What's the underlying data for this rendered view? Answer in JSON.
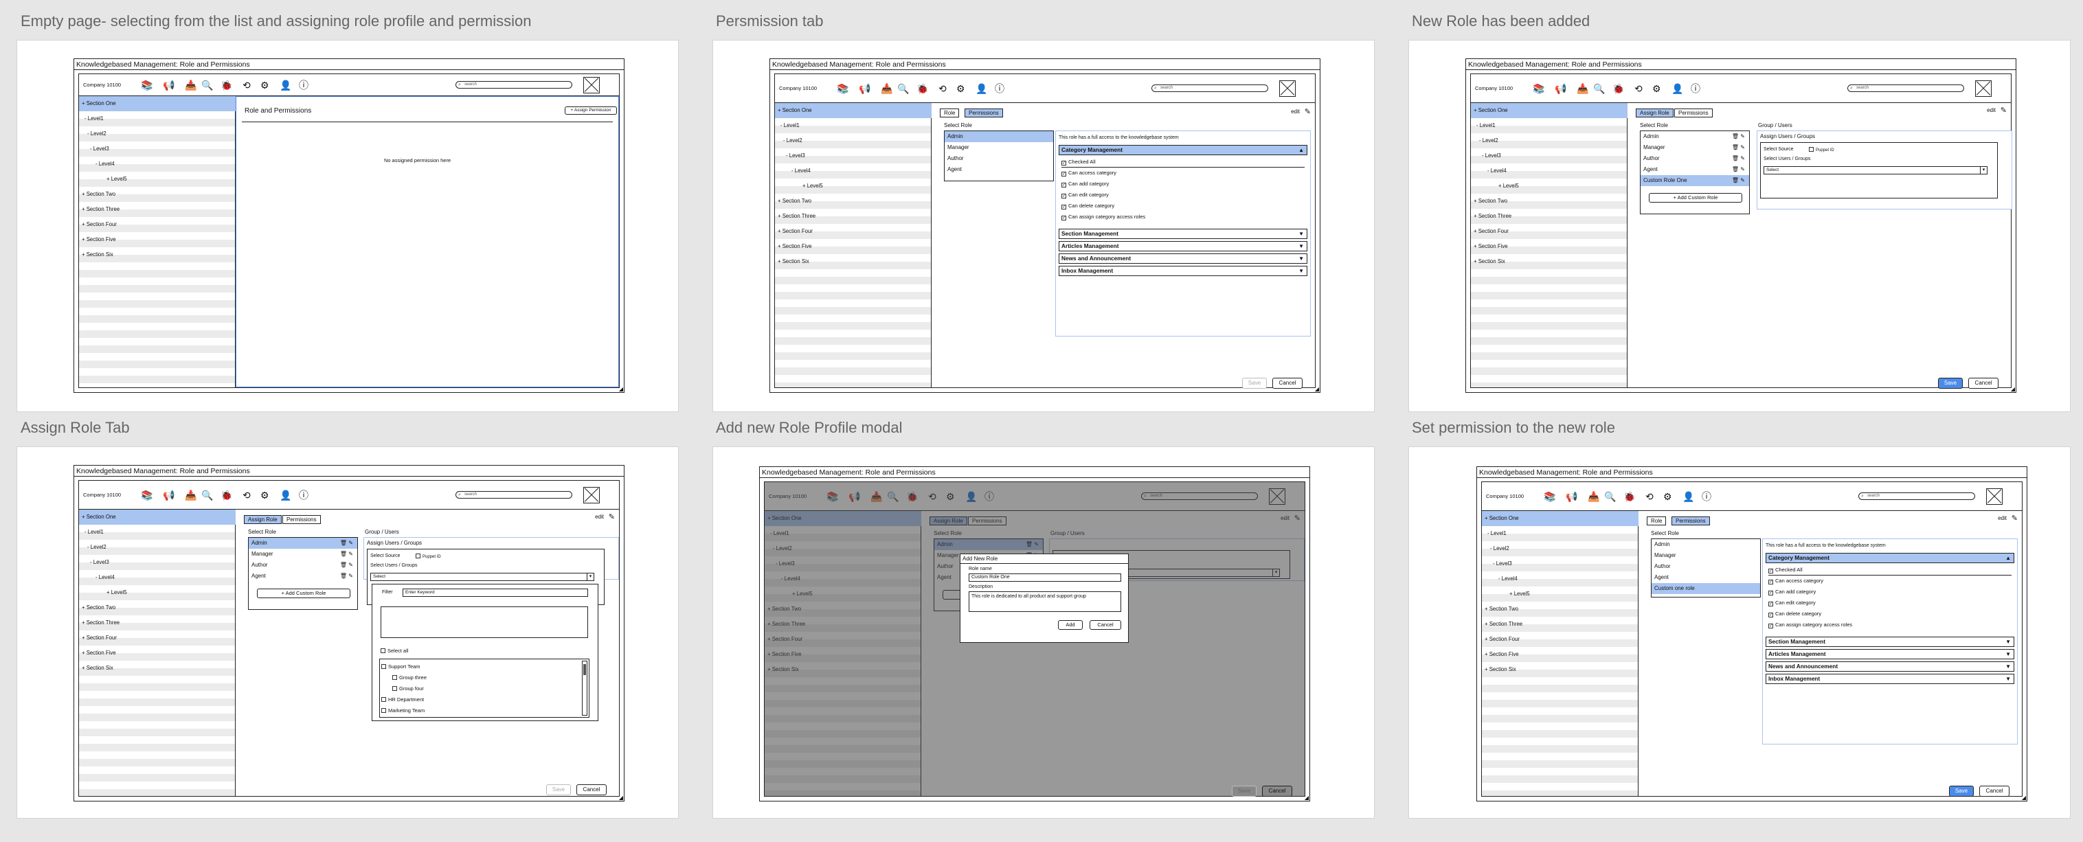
{
  "panels": [
    {
      "title": "Empty page- selecting from the list and assigning role profile and permission"
    },
    {
      "title": "Persmission tab"
    },
    {
      "title": "New Role has been added"
    },
    {
      "title": "Assign Role Tab"
    },
    {
      "title": "Add new Role Profile modal"
    },
    {
      "title": "Set permission to the new role"
    }
  ],
  "app": {
    "window_title": "Knowledgebased Management: Role and Permissions",
    "company": "Company 10100",
    "search_placeholder": "search",
    "toolbar_icons": [
      "library-icon",
      "megaphone-icon",
      "inbox-icon",
      "search-icon",
      "bug-icon",
      "history-icon",
      "gear-icon",
      "user-check-icon",
      "help-icon"
    ]
  },
  "sidebar": {
    "items": [
      "+ Section One",
      "- Level1",
      "- Level2",
      "- Level3",
      "- Level4",
      "+ Level5",
      "+ Section Two",
      "+ Section Three",
      "+ Section Four",
      "+ Section Five",
      "+ Section Six"
    ]
  },
  "empty": {
    "heading": "Role and Permissions",
    "assign_button": "+ Assign Permission",
    "empty_text": "No assigned permission here"
  },
  "tabs": {
    "role": "Role",
    "assign_role": "Assign Role",
    "permissions": "Permissions"
  },
  "edit_label": "edit",
  "select_role_label": "Select Role",
  "group_users_label": "Group / Users",
  "roles": [
    "Admin",
    "Manager",
    "Author",
    "Agent"
  ],
  "new_role": "Custom Role One",
  "new_role_lower": "Custom one role",
  "add_custom_role": "+ Add Custom Role",
  "assign_users_title": "Assign Users / Groups",
  "select_source_label": "Select Source",
  "pupper_id": "Puppet ID",
  "select_users_groups": "Select Users / Groups",
  "select_placeholder": "Select",
  "filter_label": "Filter",
  "filter_placeholder": "Enter Keyword",
  "select_all": "Select all",
  "groups": [
    "Support Team",
    "Group three",
    "Group four",
    "HR Department",
    "Marketing Team"
  ],
  "permission": {
    "desc": "This role has a full access to the knowledgebase system",
    "category": "Category Management",
    "checks": [
      "Checked All",
      "Can access category",
      "Can add category",
      "Can edit category",
      "Can delete category",
      "Can assign category access roles"
    ],
    "sections": [
      "Section Management",
      "Articles Management",
      "News and Announcement",
      "Inbox Management"
    ]
  },
  "buttons": {
    "save": "Save",
    "cancel": "Cancel",
    "add": "Add"
  },
  "modal": {
    "title": "Add New Role",
    "role_name_label": "Role name",
    "role_name_value": "Custom Role One",
    "description_label": "Description",
    "description_value": "This role is dedicated to all product and support group"
  },
  "colors": {
    "accent": "#a8c4f0",
    "primary": "#4c8ce8"
  }
}
